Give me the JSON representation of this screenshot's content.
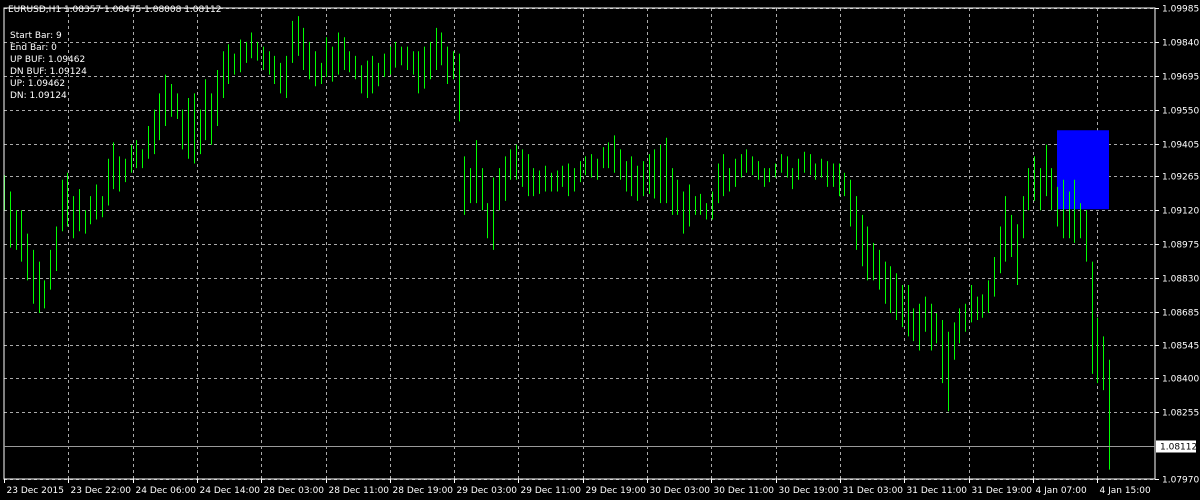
{
  "header": {
    "symbol_info": "EURUSD,H1  1.08357 1.08475 1.08008 1.08112"
  },
  "info_lines": [
    "Start Bar: 9",
    "End Bar: 0",
    "UP BUF: 1.09462",
    "DN BUF: 1.09124",
    "UP: 1.09462",
    "DN: 1.09124"
  ],
  "colors": {
    "background": "#000000",
    "bars": "#00ff00",
    "grid": "#aaaaaa",
    "zone": "#0000ff",
    "current_line": "#9a9a9a"
  },
  "chart_data": {
    "type": "bar",
    "symbol": "EURUSD",
    "timeframe": "H1",
    "ylim": [
      1.0797,
      1.09985
    ],
    "y_ticks": [
      "1.09985",
      "1.09840",
      "1.09695",
      "1.09550",
      "1.09405",
      "1.09265",
      "1.09120",
      "1.08975",
      "1.08830",
      "1.08685",
      "1.08545",
      "1.08400",
      "1.08255",
      "1.07970"
    ],
    "x_ticks": [
      "23 Dec 2015",
      "23 Dec 22:00",
      "24 Dec 06:00",
      "24 Dec 14:00",
      "28 Dec 03:00",
      "28 Dec 11:00",
      "28 Dec 19:00",
      "29 Dec 03:00",
      "29 Dec 11:00",
      "29 Dec 19:00",
      "30 Dec 03:00",
      "30 Dec 11:00",
      "30 Dec 19:00",
      "31 Dec 03:00",
      "31 Dec 11:00",
      "31 Dec 19:00",
      "4 Jan 07:00",
      "4 Jan 15:00"
    ],
    "current_price": "1.08112",
    "zone": {
      "high": 1.09462,
      "low": 1.09124,
      "start_bar": 9,
      "end_bar": 0
    },
    "grid": true,
    "bars": [
      [
        1.0927,
        1.0912
      ],
      [
        1.092,
        1.0896
      ],
      [
        1.0912,
        1.0895
      ],
      [
        1.0912,
        1.089
      ],
      [
        1.0902,
        1.0882
      ],
      [
        1.0895,
        1.0872
      ],
      [
        1.089,
        1.0868
      ],
      [
        1.0882,
        1.087
      ],
      [
        1.0895,
        1.0878
      ],
      [
        1.0905,
        1.0886
      ],
      [
        1.0925,
        1.0903
      ],
      [
        1.0928,
        1.0905
      ],
      [
        1.0918,
        1.09
      ],
      [
        1.0921,
        1.0903
      ],
      [
        1.0912,
        1.0902
      ],
      [
        1.0918,
        1.0906
      ],
      [
        1.0923,
        1.0908
      ],
      [
        1.0918,
        1.0909
      ],
      [
        1.0934,
        1.0914
      ],
      [
        1.0941,
        1.0921
      ],
      [
        1.0935,
        1.092
      ],
      [
        1.0934,
        1.0924
      ],
      [
        1.094,
        1.0928
      ],
      [
        1.0942,
        1.093
      ],
      [
        1.0938,
        1.093
      ],
      [
        1.0948,
        1.0934
      ],
      [
        1.0955,
        1.0936
      ],
      [
        1.0962,
        1.0942
      ],
      [
        1.097,
        1.0948
      ],
      [
        1.0966,
        1.0952
      ],
      [
        1.0962,
        1.0951
      ],
      [
        1.0955,
        1.0938
      ],
      [
        1.096,
        1.0934
      ],
      [
        1.0962,
        1.0932
      ],
      [
        1.0955,
        1.0936
      ],
      [
        1.0968,
        1.0942
      ],
      [
        1.0962,
        1.094
      ],
      [
        1.0972,
        1.0948
      ],
      [
        1.098,
        1.096
      ],
      [
        1.0983,
        1.0966
      ],
      [
        1.0979,
        1.097
      ],
      [
        1.0985,
        1.0971
      ],
      [
        1.0984,
        1.0975
      ],
      [
        1.0988,
        1.0977
      ],
      [
        1.0984,
        1.0976
      ],
      [
        1.0982,
        1.0972
      ],
      [
        1.098,
        1.097
      ],
      [
        1.0978,
        1.0966
      ],
      [
        1.0975,
        1.0962
      ],
      [
        1.0978,
        1.096
      ],
      [
        1.0993,
        1.0975
      ],
      [
        1.0995,
        1.0978
      ],
      [
        1.099,
        1.0972
      ],
      [
        1.0984,
        1.0968
      ],
      [
        1.098,
        1.0965
      ],
      [
        1.0975,
        1.0966
      ],
      [
        1.0986,
        1.0969
      ],
      [
        1.0982,
        1.0967
      ],
      [
        1.0988,
        1.097
      ],
      [
        1.0986,
        1.0972
      ],
      [
        1.098,
        1.0971
      ],
      [
        1.0978,
        1.0968
      ],
      [
        1.0974,
        1.0962
      ],
      [
        1.0976,
        1.096
      ],
      [
        1.0978,
        1.0962
      ],
      [
        1.0975,
        1.0965
      ],
      [
        1.0979,
        1.0969
      ],
      [
        1.0982,
        1.097
      ],
      [
        1.0984,
        1.0973
      ],
      [
        1.0982,
        1.0974
      ],
      [
        1.0982,
        1.0972
      ],
      [
        1.098,
        1.097
      ],
      [
        1.098,
        1.0962
      ],
      [
        1.0982,
        1.0964
      ],
      [
        1.0984,
        1.0968
      ],
      [
        1.099,
        1.0972
      ],
      [
        1.0988,
        1.0974
      ],
      [
        1.0982,
        1.0966
      ],
      [
        1.098,
        1.0968
      ],
      [
        1.0979,
        1.095
      ],
      [
        1.0935,
        1.091
      ],
      [
        1.093,
        1.0915
      ],
      [
        1.0942,
        1.0915
      ],
      [
        1.093,
        1.0912
      ],
      [
        1.0915,
        1.09
      ],
      [
        1.0926,
        1.0895
      ],
      [
        1.093,
        1.0912
      ],
      [
        1.0935,
        1.0916
      ],
      [
        1.0938,
        1.0925
      ],
      [
        1.094,
        1.0925
      ],
      [
        1.0938,
        1.0922
      ],
      [
        1.0936,
        1.0918
      ],
      [
        1.093,
        1.0918
      ],
      [
        1.0929,
        1.0919
      ],
      [
        1.0931,
        1.092
      ],
      [
        1.0928,
        1.092
      ],
      [
        1.0929,
        1.092
      ],
      [
        1.0931,
        1.0922
      ],
      [
        1.0932,
        1.0918
      ],
      [
        1.093,
        1.092
      ],
      [
        1.0933,
        1.0924
      ],
      [
        1.0935,
        1.0927
      ],
      [
        1.0936,
        1.0926
      ],
      [
        1.0934,
        1.0925
      ],
      [
        1.0939,
        1.093
      ],
      [
        1.0941,
        1.093
      ],
      [
        1.0944,
        1.0928
      ],
      [
        1.0938,
        1.0925
      ],
      [
        1.0933,
        1.092
      ],
      [
        1.0935,
        1.0918
      ],
      [
        1.0931,
        1.0916
      ],
      [
        1.0933,
        1.0918
      ],
      [
        1.0936,
        1.0919
      ],
      [
        1.0938,
        1.0917
      ],
      [
        1.094,
        1.0915
      ],
      [
        1.0943,
        1.0915
      ],
      [
        1.093,
        1.091
      ],
      [
        1.0925,
        1.091
      ],
      [
        1.092,
        1.0902
      ],
      [
        1.0923,
        1.0905
      ],
      [
        1.0918,
        1.091
      ],
      [
        1.0919,
        1.091
      ],
      [
        1.0915,
        1.0908
      ],
      [
        1.092,
        1.0908
      ],
      [
        1.0932,
        1.0915
      ],
      [
        1.0936,
        1.0918
      ],
      [
        1.093,
        1.092
      ],
      [
        1.0934,
        1.0922
      ],
      [
        1.0936,
        1.0926
      ],
      [
        1.0938,
        1.0928
      ],
      [
        1.0935,
        1.0927
      ],
      [
        1.0933,
        1.0925
      ],
      [
        1.093,
        1.0922
      ],
      [
        1.093,
        1.0924
      ],
      [
        1.0932,
        1.0926
      ],
      [
        1.0936,
        1.0928
      ],
      [
        1.0935,
        1.0926
      ],
      [
        1.093,
        1.0921
      ],
      [
        1.0934,
        1.0925
      ],
      [
        1.0937,
        1.0928
      ],
      [
        1.0936,
        1.0927
      ],
      [
        1.0932,
        1.0925
      ],
      [
        1.0934,
        1.0926
      ],
      [
        1.0933,
        1.0922
      ],
      [
        1.0932,
        1.0922
      ],
      [
        1.0932,
        1.0918
      ],
      [
        1.0928,
        1.0918
      ],
      [
        1.0925,
        1.0905
      ],
      [
        1.0918,
        1.0895
      ],
      [
        1.091,
        1.0888
      ],
      [
        1.0905,
        1.0882
      ],
      [
        1.0898,
        1.0882
      ],
      [
        1.0895,
        1.0878
      ],
      [
        1.089,
        1.0872
      ],
      [
        1.0888,
        1.0868
      ],
      [
        1.0885,
        1.0865
      ],
      [
        1.088,
        1.0862
      ],
      [
        1.088,
        1.0858
      ],
      [
        1.087,
        1.0856
      ],
      [
        1.0872,
        1.0852
      ],
      [
        1.0875,
        1.086
      ],
      [
        1.0872,
        1.0852
      ],
      [
        1.0868,
        1.0855
      ],
      [
        1.0865,
        1.0838
      ],
      [
        1.086,
        1.0826
      ],
      [
        1.0864,
        1.0848
      ],
      [
        1.087,
        1.0855
      ],
      [
        1.0872,
        1.086
      ],
      [
        1.088,
        1.0864
      ],
      [
        1.0875,
        1.0865
      ],
      [
        1.0876,
        1.0866
      ],
      [
        1.0882,
        1.0868
      ],
      [
        1.0892,
        1.0875
      ],
      [
        1.0905,
        1.0885
      ],
      [
        1.0918,
        1.089
      ],
      [
        1.091,
        1.0892
      ],
      [
        1.0906,
        1.088
      ],
      [
        1.0918,
        1.09
      ],
      [
        1.093,
        1.0912
      ],
      [
        1.0935,
        1.0916
      ],
      [
        1.093,
        1.0912
      ],
      [
        1.094,
        1.0918
      ],
      [
        1.093,
        1.0912
      ],
      [
        1.0922,
        1.0905
      ],
      [
        1.0925,
        1.09
      ],
      [
        1.092,
        1.09
      ],
      [
        1.0925,
        1.0898
      ],
      [
        1.0915,
        1.09
      ],
      [
        1.0912,
        1.089
      ],
      [
        1.089,
        1.0842
      ],
      [
        1.0866,
        1.0838
      ],
      [
        1.0858,
        1.0835
      ],
      [
        1.0848,
        1.0801
      ]
    ]
  }
}
